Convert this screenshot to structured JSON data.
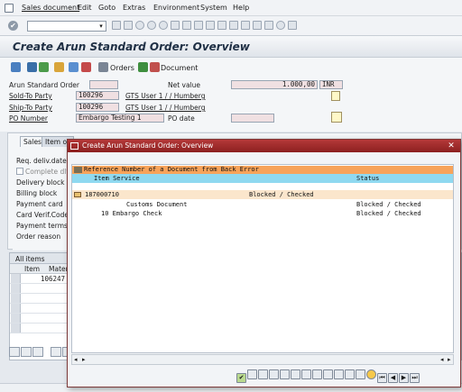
{
  "menubar": {
    "items": [
      "Sales document",
      "Edit",
      "Goto",
      "Extras",
      "Environment",
      "System",
      "Help"
    ]
  },
  "title": "Create Arun Standard Order: Overview",
  "app_toolbar": {
    "orders_label": "Orders",
    "document_label": "Document"
  },
  "header": {
    "standard_order_label": "Arun Standard Order",
    "net_value_label": "Net value",
    "net_value": "1.000,00",
    "currency": "INR",
    "sold_to_label": "Sold-To Party",
    "sold_to_value": "100296",
    "sold_to_desc": "GTS User 1 / / Humberg",
    "ship_to_label": "Ship-To Party",
    "ship_to_value": "100296",
    "ship_to_desc": "GTS User 1 / / Humberg",
    "po_number_label": "PO Number",
    "po_number_value": "Embargo Testing 1",
    "po_date_label": "PO date"
  },
  "tabs": [
    "Sales",
    "Item ov"
  ],
  "sales_tab": {
    "fields": [
      "Req. deliv.date",
      "Complete dlv.",
      "Delivery block",
      "Billing block",
      "Payment card",
      "Card Verif.Code",
      "Payment terms",
      "Order reason"
    ]
  },
  "items": {
    "section_label": "All items",
    "col_item": "Item",
    "col_material": "Materi",
    "row1_item": "10",
    "row1_material": "6247"
  },
  "dialog": {
    "title": "Create Arun Standard Order: Overview",
    "header_line": "Reference Number of a Document from Back Error",
    "col_item_service": "Item Service",
    "col_status": "Status",
    "rows": [
      {
        "text": "187000710",
        "status": "Blocked / Checked"
      },
      {
        "text": "Customs Document",
        "status": "Blocked / Checked"
      },
      {
        "text": "10 Embargo Check",
        "status": "Blocked / Checked"
      }
    ]
  },
  "colors": {
    "dialog_title": "#a42b2b",
    "header_orange": "#f7a35a",
    "header_cyan": "#8fd9f0",
    "row_highlight": "#fbe6cc"
  }
}
